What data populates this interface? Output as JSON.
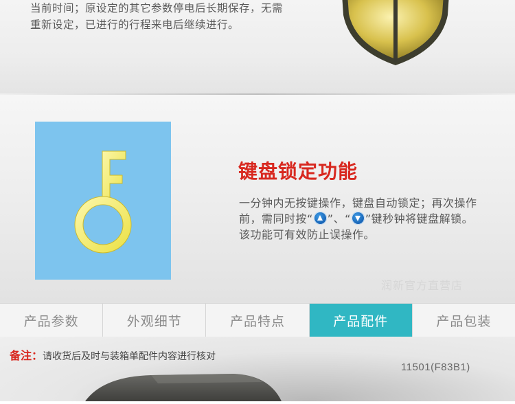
{
  "top_section": {
    "lines": [
      "当前时间；原设定的其它参数停电后长期保存，无需",
      "重新设定，已进行的行程来电后继续进行。"
    ]
  },
  "feature": {
    "title": "键盘锁定功能",
    "desc_line1": "一分钟内无按键操作，键盘自动锁定；再次操作",
    "desc_line2_a": "前，需同时按“",
    "desc_line2_b": "”、“",
    "desc_line2_c": "”键秒钟将键盘解锁。",
    "desc_line3": "该功能可有效防止误操作。",
    "icon_box_color": "#7dc4ee",
    "key_icon_color": "#f3e96b"
  },
  "watermark": "润新官方直营店",
  "tabs": [
    {
      "label": "产品参数",
      "active": false
    },
    {
      "label": "外观细节",
      "active": false
    },
    {
      "label": "产品特点",
      "active": false
    },
    {
      "label": "产品配件",
      "active": true
    },
    {
      "label": "产品包装",
      "active": false
    }
  ],
  "note": {
    "label": "备注：",
    "text": "请收货后及时与装箱单配件内容进行核对"
  },
  "model_code": "11501(F83B1)",
  "colors": {
    "accent_red": "#d8281f",
    "active_tab": "#30b7c3"
  }
}
